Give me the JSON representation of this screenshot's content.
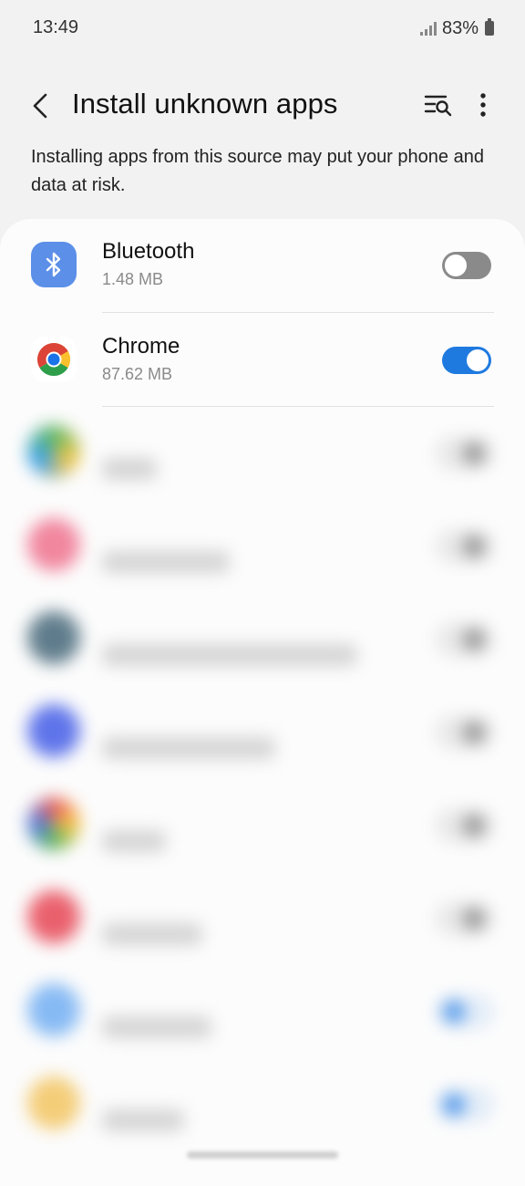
{
  "status_bar": {
    "time": "13:49",
    "battery": "83%"
  },
  "app_bar": {
    "title": "Install unknown apps"
  },
  "description": "Installing apps from this source may put your phone and data at risk.",
  "apps": [
    {
      "name": "Bluetooth",
      "size": "1.48 MB",
      "allowed": false,
      "icon": "bluetooth-icon",
      "icon_color": "#5b8fe8"
    },
    {
      "name": "Chrome",
      "size": "87.62 MB",
      "allowed": true,
      "icon": "chrome-icon",
      "icon_color": "#ffffff"
    }
  ],
  "colors": {
    "toggle_on": "#1f7ae0",
    "toggle_off": "#8a8a8a",
    "background": "#f2f2f2",
    "card": "#fcfcfc"
  }
}
